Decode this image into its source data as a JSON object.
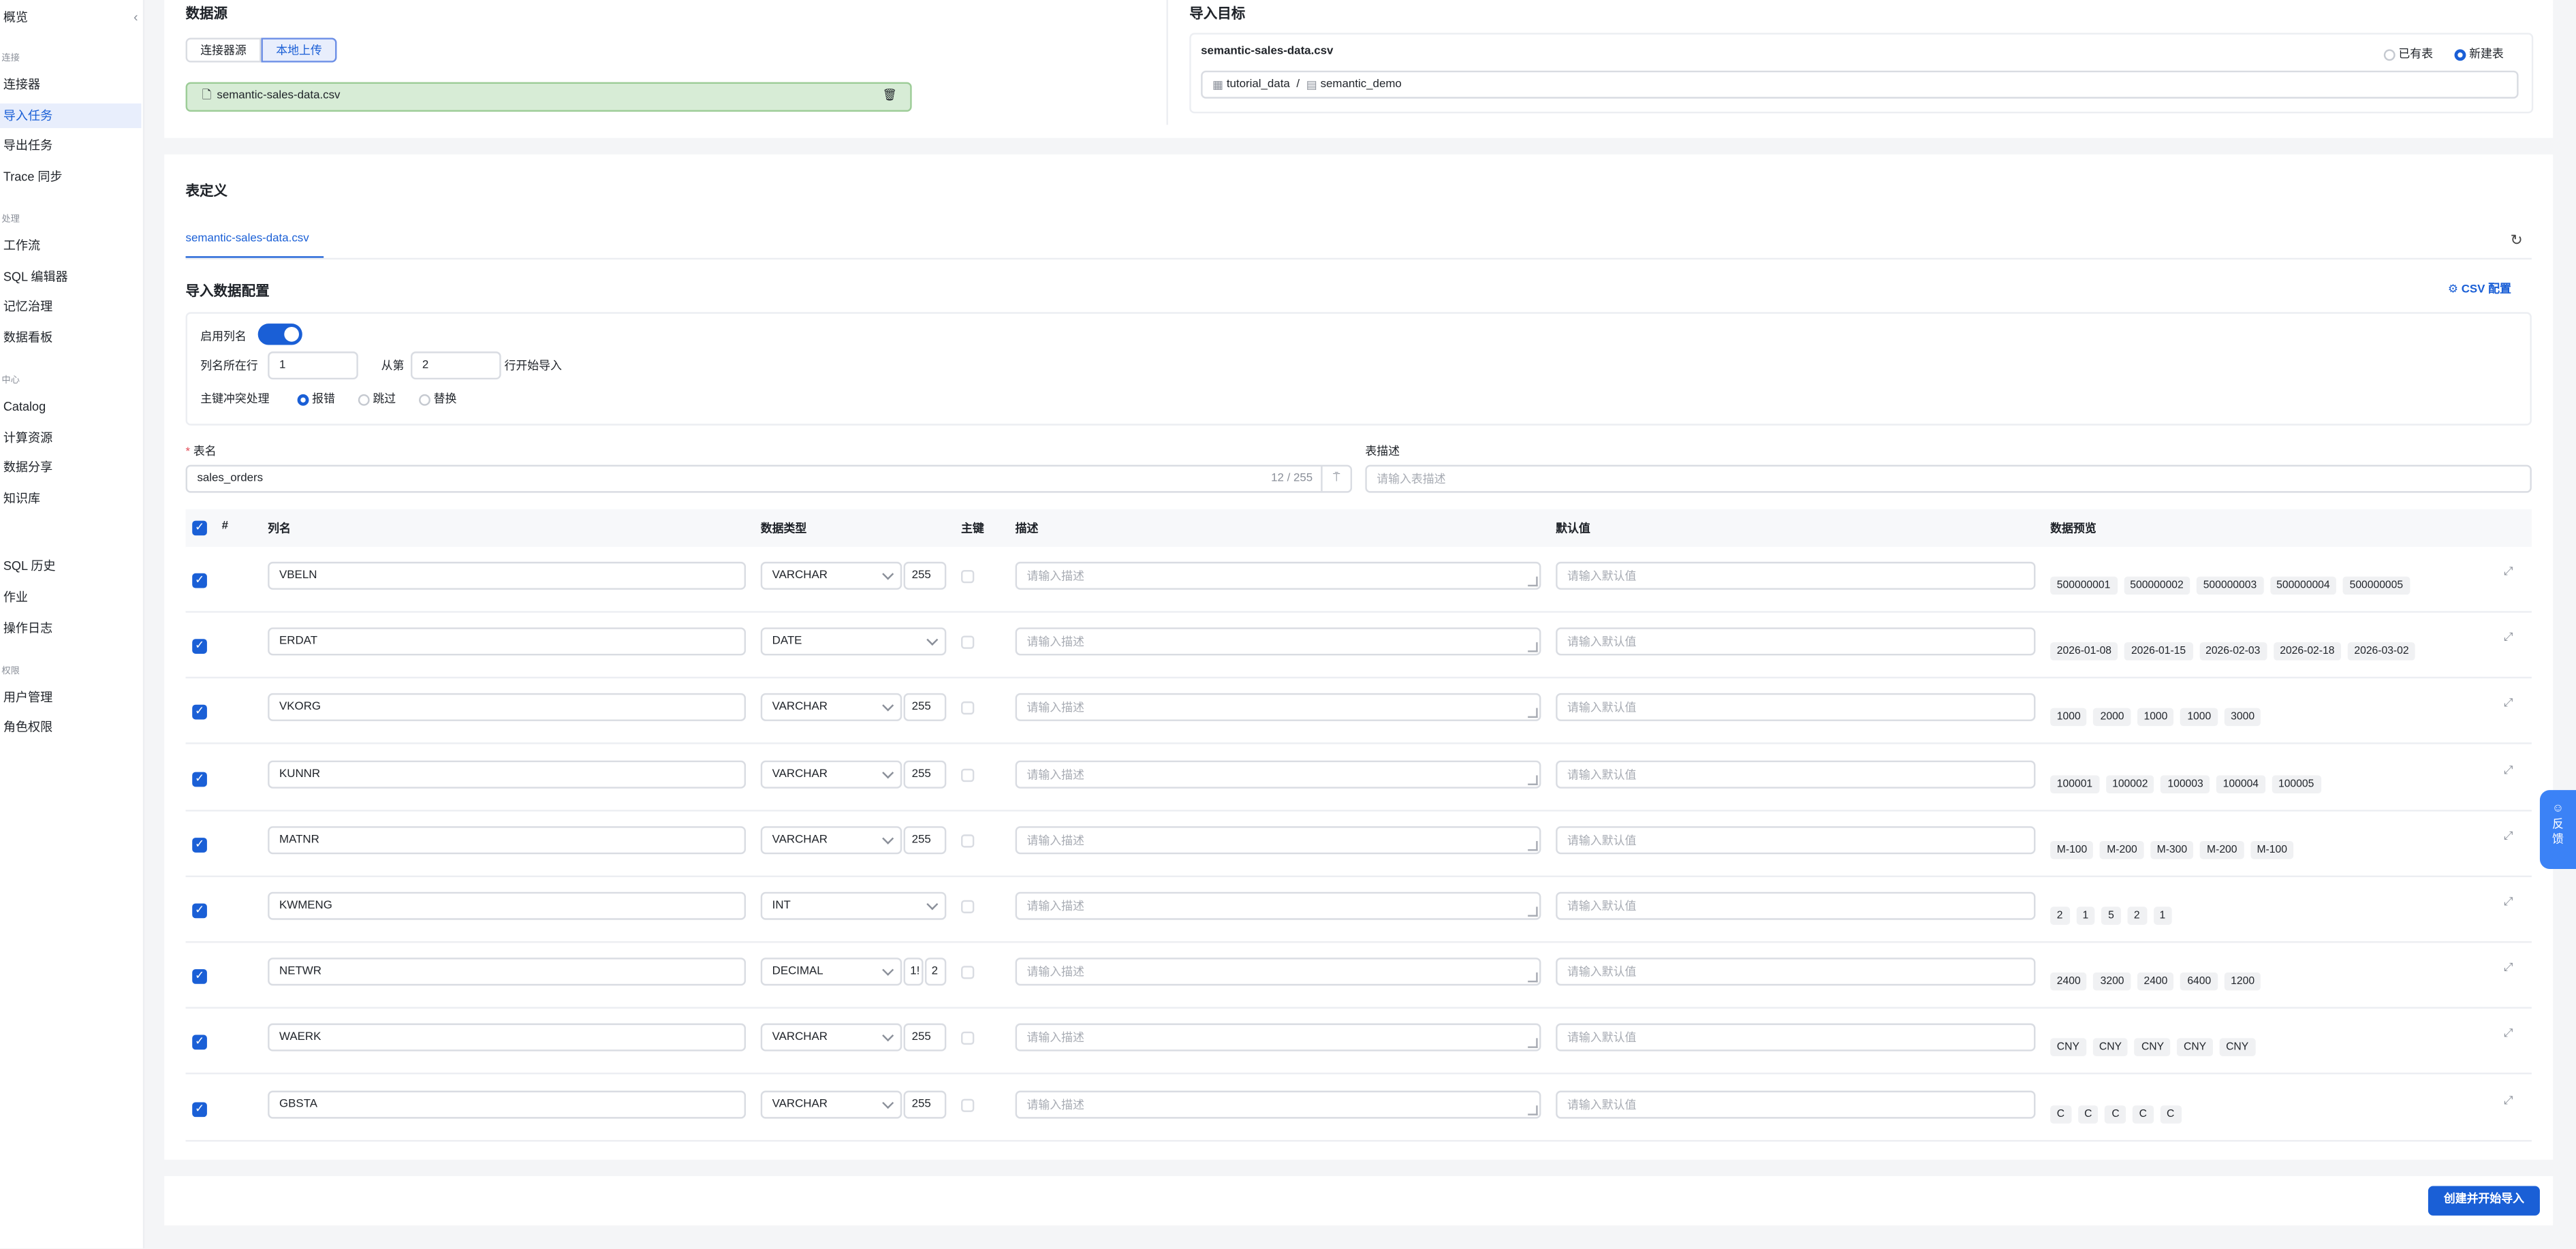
{
  "sidebar": {
    "top": "概览",
    "groups": {
      "connect": "连接",
      "process": "处理",
      "center": "中心",
      "perm": "权限"
    },
    "items": [
      "连接器",
      "导入任务",
      "导出任务",
      "Trace 同步",
      "工作流",
      "SQL 编辑器",
      "记忆治理",
      "数据看板",
      "Catalog",
      "计算资源",
      "数据分享",
      "知识库",
      "SQL 历史",
      "作业",
      "操作日志",
      "用户管理",
      "角色权限"
    ],
    "active": "导入任务"
  },
  "source": {
    "title": "数据源",
    "tab_connector": "连接器源",
    "tab_local": "本地上传",
    "file_name": "semantic-sales-data.csv"
  },
  "target": {
    "title": "导入目标",
    "file_name": "semantic-sales-data.csv",
    "opt_existing": "已有表",
    "opt_new": "新建表",
    "catalog": "tutorial_data",
    "sep": "/",
    "schema": "semantic_demo"
  },
  "definition": {
    "title": "表定义",
    "tab": "semantic-sales-data.csv",
    "config_title": "导入数据配置",
    "csv_config": "CSV 配置",
    "enable_header": "启用列名",
    "header_row_label": "列名所在行",
    "header_row_value": "1",
    "from_label": "从第",
    "from_value": "2",
    "from_suffix": "行开始导入",
    "conflict_label": "主键冲突处理",
    "conflict_options": [
      "报错",
      "跳过",
      "替换"
    ],
    "table_name_label": "表名",
    "table_name_value": "sales_orders",
    "table_name_count": "12 / 255",
    "table_desc_label": "表描述",
    "table_desc_placeholder": "请输入表描述"
  },
  "grid": {
    "headers": {
      "num": "#",
      "col": "列名",
      "type": "数据类型",
      "pk": "主键",
      "desc": "描述",
      "default": "默认值",
      "preview": "数据预览"
    },
    "desc_placeholder": "请输入描述",
    "default_placeholder": "请输入默认值",
    "rows": [
      {
        "name": "VBELN",
        "type": "VARCHAR",
        "len": "255",
        "preview": [
          "500000001",
          "500000002",
          "500000003",
          "500000004",
          "500000005"
        ]
      },
      {
        "name": "ERDAT",
        "type": "DATE",
        "len": "",
        "preview": [
          "2026-01-08",
          "2026-01-15",
          "2026-02-03",
          "2026-02-18",
          "2026-03-02"
        ]
      },
      {
        "name": "VKORG",
        "type": "VARCHAR",
        "len": "255",
        "preview": [
          "1000",
          "2000",
          "1000",
          "1000",
          "3000"
        ]
      },
      {
        "name": "KUNNR",
        "type": "VARCHAR",
        "len": "255",
        "preview": [
          "100001",
          "100002",
          "100003",
          "100004",
          "100005"
        ]
      },
      {
        "name": "MATNR",
        "type": "VARCHAR",
        "len": "255",
        "preview": [
          "M-100",
          "M-200",
          "M-300",
          "M-200",
          "M-100"
        ]
      },
      {
        "name": "KWMENG",
        "type": "INT",
        "len": "",
        "preview": [
          "2",
          "1",
          "5",
          "2",
          "1"
        ]
      },
      {
        "name": "NETWR",
        "type": "DECIMAL",
        "len": "1!",
        "scale": "2",
        "preview": [
          "2400",
          "3200",
          "2400",
          "6400",
          "1200"
        ]
      },
      {
        "name": "WAERK",
        "type": "VARCHAR",
        "len": "255",
        "preview": [
          "CNY",
          "CNY",
          "CNY",
          "CNY",
          "CNY"
        ]
      },
      {
        "name": "GBSTA",
        "type": "VARCHAR",
        "len": "255",
        "preview": [
          "C",
          "C",
          "C",
          "C",
          "C"
        ]
      }
    ]
  },
  "footer": {
    "submit": "创建并开始导入"
  },
  "feedback": "反馈",
  "colors": {
    "accent": "#1a5fd6",
    "file_bg": "#d7ecd6"
  }
}
